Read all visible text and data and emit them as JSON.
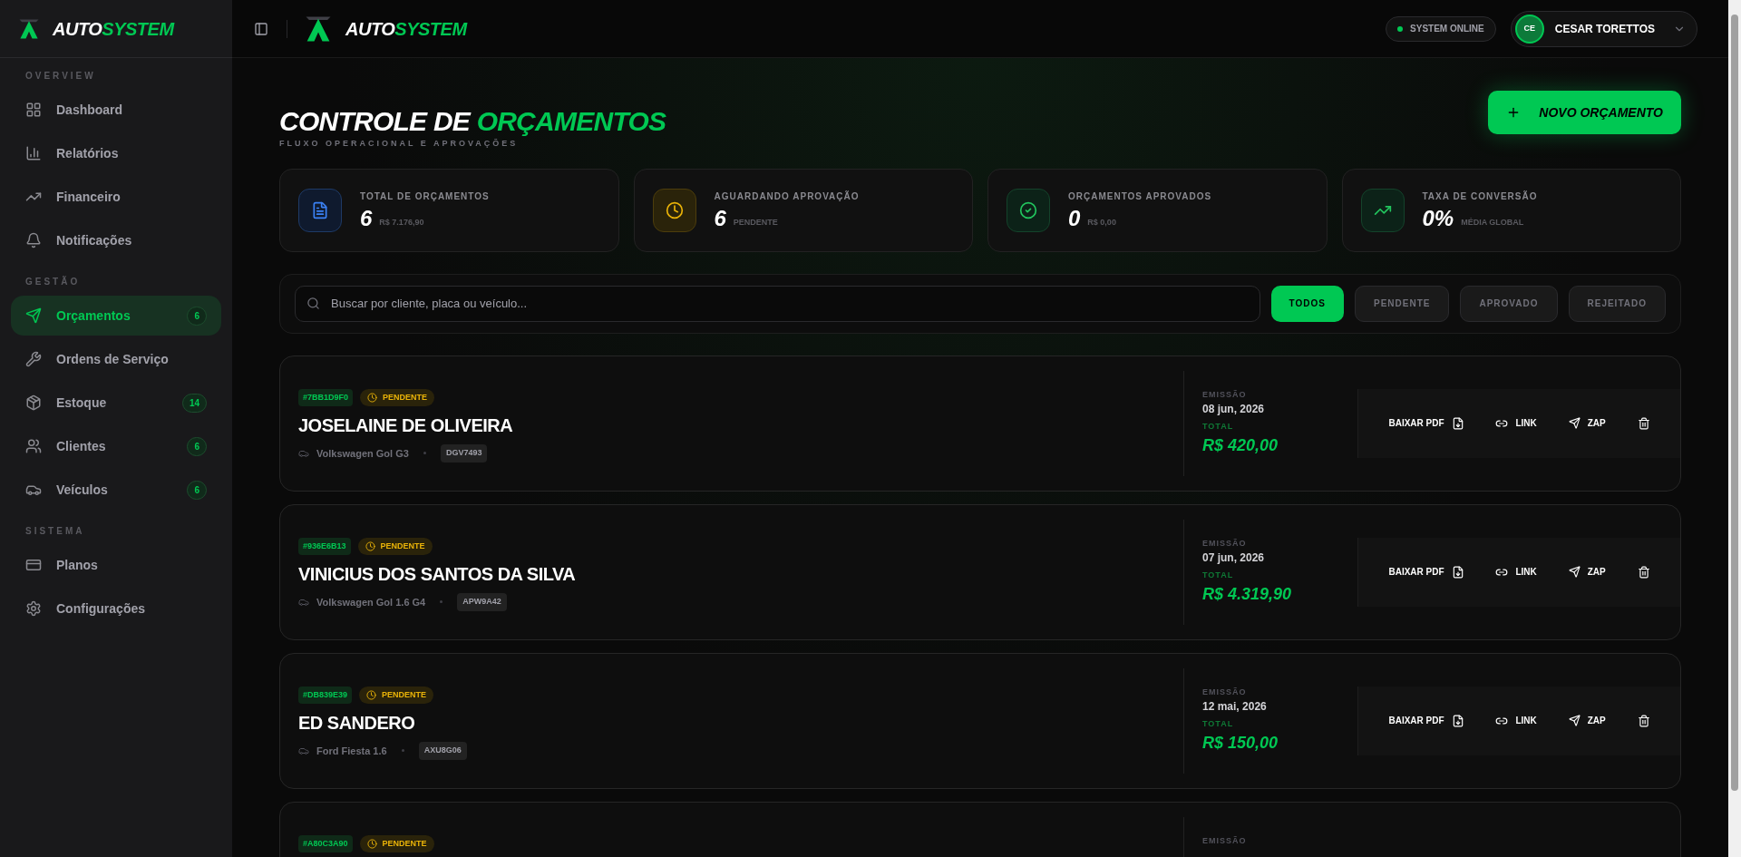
{
  "brand": {
    "part1": "AUTO",
    "part2": "SYSTEM"
  },
  "header_brand": {
    "part1": "AUTO",
    "part2": "SYSTEM"
  },
  "sidebar": {
    "sections": [
      {
        "title": "OVERVIEW",
        "items": [
          {
            "label": "Dashboard",
            "selected": false
          },
          {
            "label": "Relatórios",
            "selected": false
          },
          {
            "label": "Financeiro",
            "selected": false
          },
          {
            "label": "Notificações",
            "selected": false
          }
        ]
      },
      {
        "title": "GESTÃO",
        "items": [
          {
            "label": "Orçamentos",
            "badge": "6",
            "selected": true
          },
          {
            "label": "Ordens de Serviço",
            "selected": false
          },
          {
            "label": "Estoque",
            "badge": "14",
            "selected": false
          },
          {
            "label": "Clientes",
            "badge": "6",
            "selected": false
          },
          {
            "label": "Veículos",
            "badge": "6",
            "selected": false
          }
        ]
      },
      {
        "title": "SISTEMA",
        "items": [
          {
            "label": "Planos",
            "selected": false
          },
          {
            "label": "Configurações",
            "selected": false
          }
        ]
      }
    ]
  },
  "header": {
    "status": "SYSTEM ONLINE",
    "user": {
      "initials": "CE",
      "name": "CESAR TORETTOS"
    }
  },
  "page": {
    "title_part1": "CONTROLE DE",
    "title_part2": "ORÇAMENTOS",
    "subtitle": "FLUXO OPERACIONAL E APROVAÇÕES",
    "new_button": "NOVO ORÇAMENTO"
  },
  "stats": [
    {
      "kind": "doc",
      "label": "TOTAL DE ORÇAMENTOS",
      "value": "6",
      "sub": "R$ 7.176,90"
    },
    {
      "kind": "clock",
      "label": "AGUARDANDO APROVAÇÃO",
      "value": "6",
      "sub": "PENDENTE"
    },
    {
      "kind": "check",
      "label": "ORÇAMENTOS APROVADOS",
      "value": "0",
      "sub": "R$ 0,00"
    },
    {
      "kind": "trend",
      "label": "TAXA DE CONVERSÃO",
      "value": "0%",
      "sub": "MÉDIA GLOBAL"
    }
  ],
  "search": {
    "placeholder": "Buscar por cliente, placa ou veículo..."
  },
  "filters": [
    {
      "label": "TODOS",
      "selected": true
    },
    {
      "label": "PENDENTE",
      "selected": false
    },
    {
      "label": "APROVADO",
      "selected": false
    },
    {
      "label": "REJEITADO",
      "selected": false
    }
  ],
  "quotes": [
    {
      "id": "#7BB1D9F0",
      "kind": "pending",
      "status_label": "PENDENTE",
      "client": "JOSELAINE DE OLIVEIRA",
      "vehicle": "Volkswagen Gol G3",
      "plate": "DGV7493",
      "emission_label": "EMISSÃO",
      "date": "08 jun, 2026",
      "total_label": "TOTAL",
      "total": "R$ 420,00",
      "actions": {
        "pdf": "BAIXAR PDF",
        "link": "LINK",
        "zap": "ZAP"
      }
    },
    {
      "id": "#936E6B13",
      "kind": "pending",
      "status_label": "PENDENTE",
      "client": "VINICIUS DOS SANTOS DA SILVA",
      "vehicle": "Volkswagen Gol 1.6 G4",
      "plate": "APW9A42",
      "emission_label": "EMISSÃO",
      "date": "07 jun, 2026",
      "total_label": "TOTAL",
      "total": "R$ 4.319,90",
      "actions": {
        "pdf": "BAIXAR PDF",
        "link": "LINK",
        "zap": "ZAP"
      }
    },
    {
      "id": "#DB839E39",
      "kind": "pending",
      "status_label": "PENDENTE",
      "client": "ED SANDERO",
      "vehicle": "Ford Fiesta 1.6",
      "plate": "AXU8G06",
      "emission_label": "EMISSÃO",
      "date": "12 mai, 2026",
      "total_label": "TOTAL",
      "total": "R$ 150,00",
      "actions": {
        "pdf": "BAIXAR PDF",
        "link": "LINK",
        "zap": "ZAP"
      }
    },
    {
      "id": "#A80C3A90",
      "kind": "pending",
      "status_label": "PENDENTE",
      "emission_label": "EMISSÃO"
    }
  ]
}
